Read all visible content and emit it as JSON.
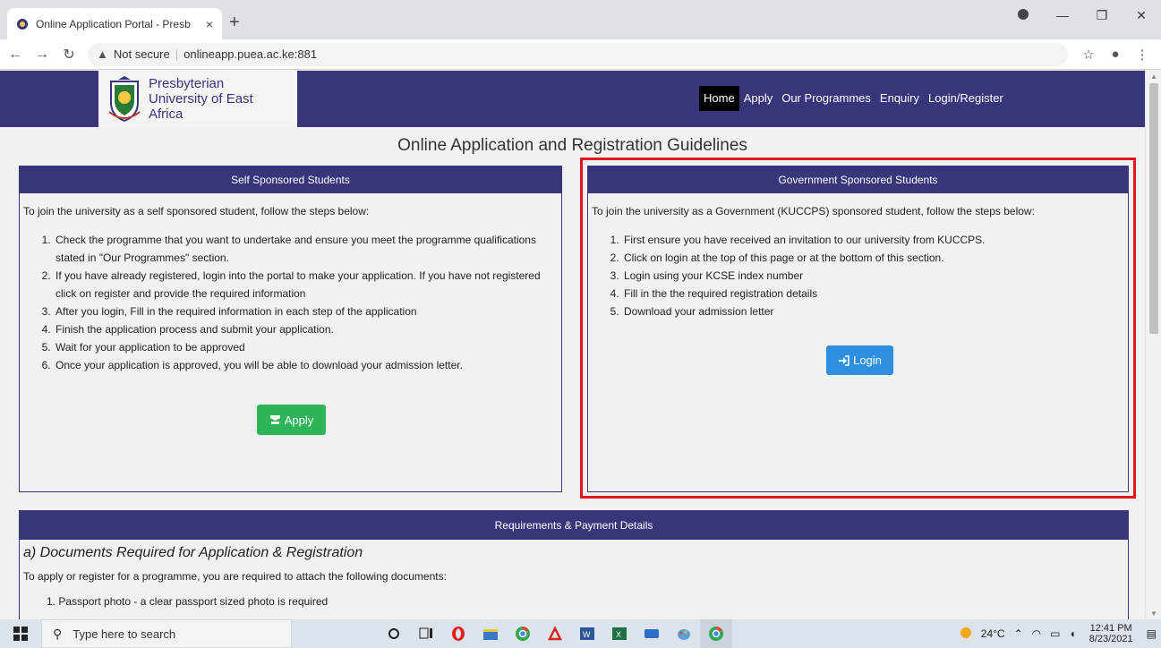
{
  "browser": {
    "tab_title": "Online Application Portal - Presb",
    "tab_close": "×",
    "new_tab": "+",
    "not_secure": "Not secure",
    "url": "onlineapp.puea.ac.ke:881"
  },
  "site": {
    "university_name_line1": "Presbyterian",
    "university_name_line2": "University of East",
    "university_name_line3": "Africa",
    "menu": {
      "home": "Home",
      "apply": "Apply",
      "programmes": "Our Programmes",
      "enquiry": "Enquiry",
      "login_register": "Login/Register"
    },
    "page_title": "Online Application and Registration Guidelines"
  },
  "self_sponsored": {
    "heading": "Self Sponsored Students",
    "intro": "To join the university as a self sponsored student, follow the steps below:",
    "steps": [
      "Check the programme that you want to undertake and ensure you meet the programme qualifications stated in \"Our Programmes\" section.",
      "If you have already registered, login into the portal to make your application. If you have not registered click on register and provide the required information",
      "After you login, Fill in the required information in each step of the application",
      "Finish the application process and submit your application.",
      "Wait for your application to be approved",
      "Once your application is approved, you will be able to download your admission letter."
    ],
    "apply_button": "Apply"
  },
  "government_sponsored": {
    "heading": "Government Sponsored Students",
    "intro": "To join the university as a Government (KUCCPS) sponsored student, follow the steps below:",
    "steps": [
      "First ensure you have received an invitation to our university from KUCCPS.",
      "Click on login at the top of this page or at the bottom of this section.",
      "Login using your KCSE index number",
      "Fill in the the required registration details",
      "Download your admission letter"
    ],
    "login_button": "Login"
  },
  "requirements": {
    "heading": "Requirements & Payment Details",
    "subtitle": "a) Documents Required for Application & Registration",
    "text": "To apply or register for a programme, you are required to attach the following documents:",
    "first_item": "1. Passport photo - a clear passport sized photo is required"
  },
  "taskbar": {
    "search_placeholder": "Type here to search",
    "weather": "24°C",
    "time": "12:41 PM",
    "date": "8/23/2021"
  },
  "colors": {
    "brand": "#38357b",
    "apply_green": "#2fb45a",
    "login_blue": "#2e8ee0",
    "highlight_red": "#e3141d"
  }
}
